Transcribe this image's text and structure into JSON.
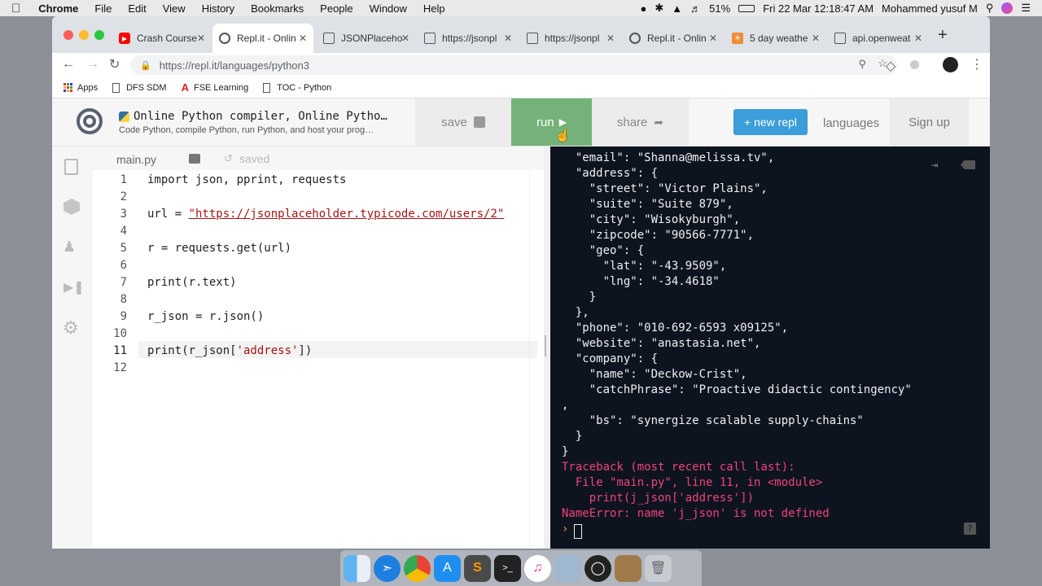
{
  "menubar": {
    "items": [
      "Chrome",
      "File",
      "Edit",
      "View",
      "History",
      "Bookmarks",
      "People",
      "Window",
      "Help"
    ],
    "battery": "51%",
    "datetime": "Fri 22 Mar  12:18:47 AM",
    "user": "Mohammed yusuf M"
  },
  "tabs": [
    {
      "label": "Crash Course",
      "icon": "youtube-icon",
      "color": "#ff0000"
    },
    {
      "label": "Repl.it - Onlin",
      "icon": "replit-icon",
      "color": "#555"
    },
    {
      "label": "JSONPlaceho",
      "icon": "tab-icon",
      "color": "#555"
    },
    {
      "label": "https://jsonpl",
      "icon": "page-icon",
      "color": "#555"
    },
    {
      "label": "https://jsonpl",
      "icon": "page-icon",
      "color": "#555"
    },
    {
      "label": "Repl.it - Onlin",
      "icon": "replit-icon",
      "color": "#555"
    },
    {
      "label": "5 day weathe",
      "icon": "weather-icon",
      "color": "#f28b30"
    },
    {
      "label": "api.openweat",
      "icon": "page-icon",
      "color": "#555"
    }
  ],
  "url": "https://repl.it/languages/python3",
  "bookmarks": [
    "Apps",
    "DFS SDM",
    "FSE Learning",
    "TOC - Python"
  ],
  "repl": {
    "title": "Online Python compiler, Online Pytho…",
    "subtitle": "Code Python, compile Python, run Python, and host your prog…",
    "save": "save",
    "run": "run",
    "share": "share",
    "new_repl": "+ new repl",
    "languages": "languages",
    "signup": "Sign up"
  },
  "editor": {
    "filename": "main.py",
    "status": "saved",
    "lines": [
      "import json, pprint, requests",
      "",
      "url = \"https://jsonplaceholder.typicode.com/users/2\"",
      "",
      "r = requests.get(url)",
      "",
      "print(r.text)",
      "",
      "r_json = r.json()",
      "",
      "print(r_json['address'])",
      ""
    ],
    "active_line": 11
  },
  "console": {
    "lines": [
      "  \"email\": \"Shanna@melissa.tv\",",
      "  \"address\": {",
      "    \"street\": \"Victor Plains\",",
      "    \"suite\": \"Suite 879\",",
      "    \"city\": \"Wisokyburgh\",",
      "    \"zipcode\": \"90566-7771\",",
      "    \"geo\": {",
      "      \"lat\": \"-43.9509\",",
      "      \"lng\": \"-34.4618\"",
      "    }",
      "  },",
      "  \"phone\": \"010-692-6593 x09125\",",
      "  \"website\": \"anastasia.net\",",
      "  \"company\": {",
      "    \"name\": \"Deckow-Crist\",",
      "    \"catchPhrase\": \"Proactive didactic contingency\"",
      ",",
      "    \"bs\": \"synergize scalable supply-chains\"",
      "  }",
      "}"
    ],
    "error_lines": [
      "Traceback (most recent call last):",
      "  File \"main.py\", line 11, in <module>",
      "    print(j_json['address'])",
      "NameError: name 'j_json' is not defined"
    ],
    "prompt": "›",
    "help": "?"
  }
}
